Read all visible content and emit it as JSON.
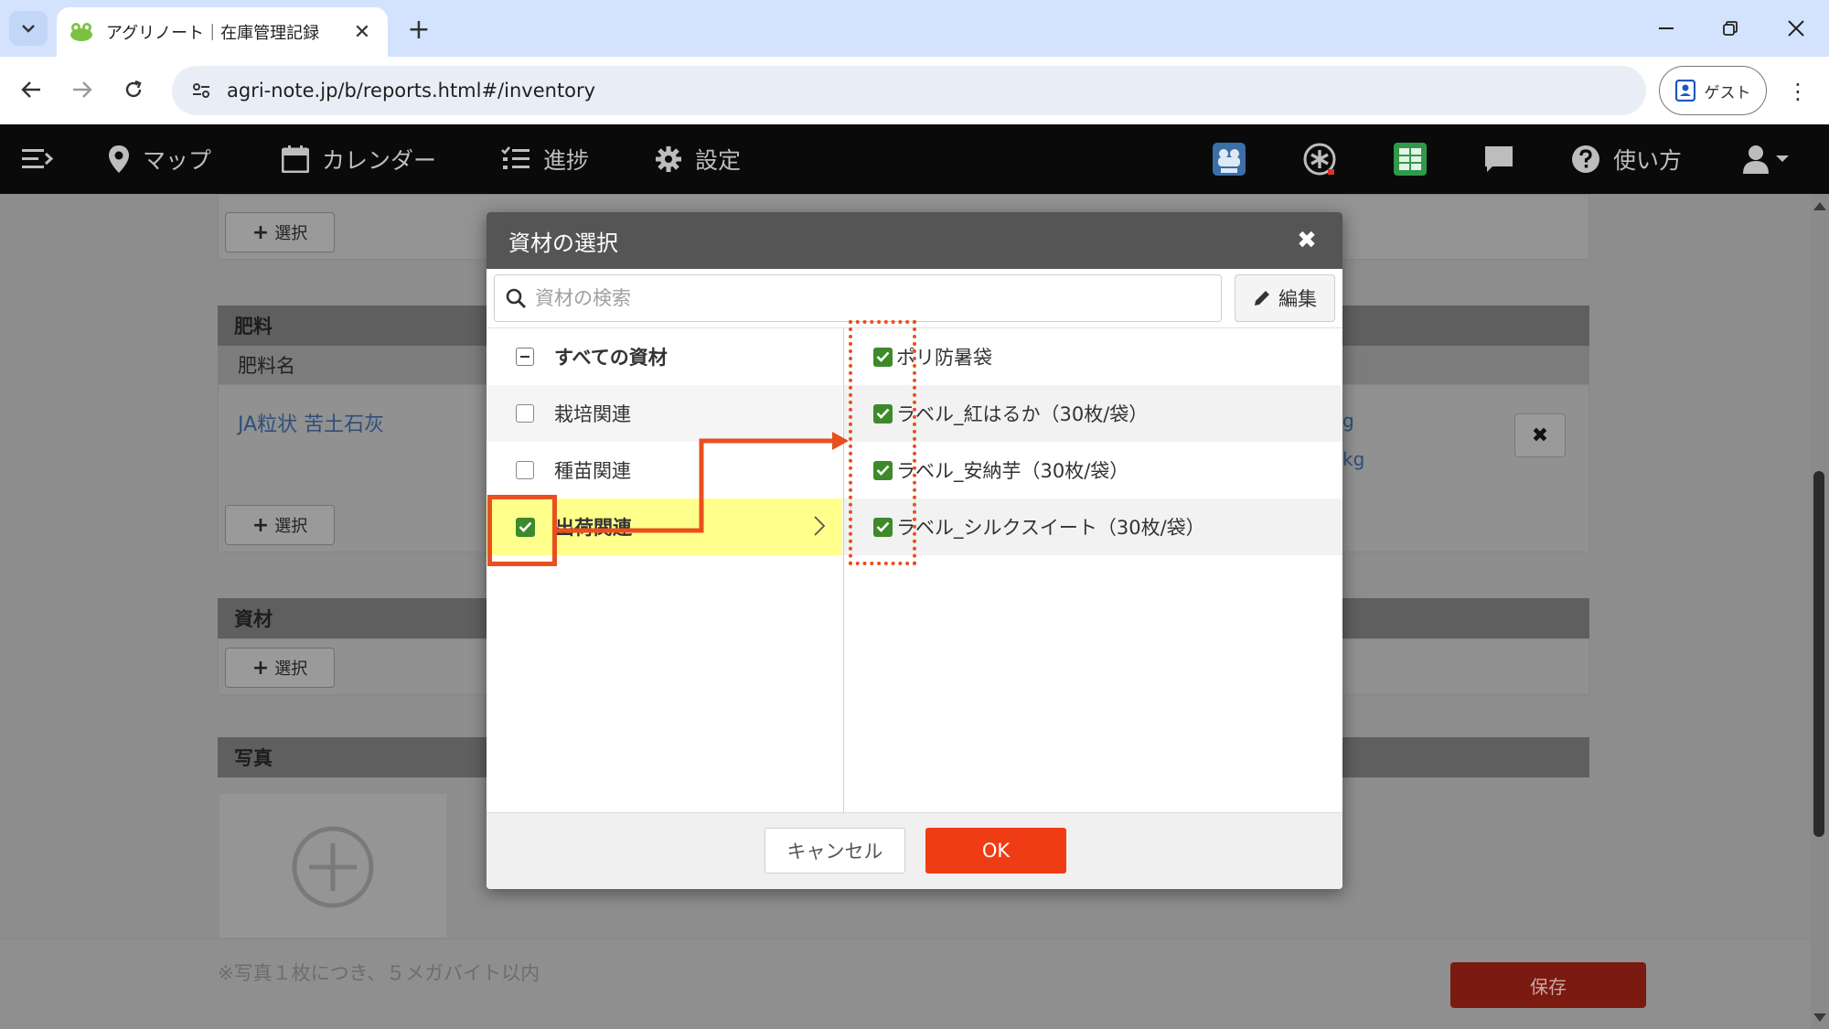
{
  "browser": {
    "tab_title": "アグリノート｜在庫管理記録",
    "url": "agri-note.jp/b/reports.html#/inventory",
    "profile_label": "ゲスト"
  },
  "app_nav": {
    "items": [
      {
        "label": "マップ",
        "icon": "map-pin-icon"
      },
      {
        "label": "カレンダー",
        "icon": "calendar-icon"
      },
      {
        "label": "進捗",
        "icon": "list-icon"
      },
      {
        "label": "設定",
        "icon": "gear-icon"
      }
    ],
    "help_label": "使い方"
  },
  "page": {
    "select_label": "選択",
    "fertilizer": {
      "section_title": "肥料",
      "column_header": "肥料名",
      "item_name": "JA粒状 苦土石灰",
      "amount_tail_1": "g",
      "amount_tail_2": "kg"
    },
    "materials": {
      "section_title": "資材"
    },
    "photos": {
      "section_title": "写真",
      "note": "※写真１枚につき、５メガバイト以内"
    },
    "save_label": "保存"
  },
  "modal": {
    "title": "資材の選択",
    "search_placeholder": "資材の検索",
    "edit_label": "編集",
    "categories": [
      {
        "label": "すべての資材",
        "state": "partial"
      },
      {
        "label": "栽培関連",
        "state": "unchecked"
      },
      {
        "label": "種苗関連",
        "state": "unchecked"
      },
      {
        "label": "出荷関連",
        "state": "checked"
      }
    ],
    "materials": [
      {
        "label": "ポリ防暑袋",
        "checked": true
      },
      {
        "label": "ラベル_紅はるか（30枚/袋）",
        "checked": true
      },
      {
        "label": "ラベル_安納芋（30枚/袋）",
        "checked": true
      },
      {
        "label": "ラベル_シルクスイート（30枚/袋）",
        "checked": true
      }
    ],
    "cancel_label": "キャンセル",
    "ok_label": "OK"
  },
  "colors": {
    "annotation": "#e8501e",
    "ok_button": "#f03c14",
    "active_row": "#ffff8c",
    "checkbox_checked": "#3e8a2a"
  }
}
